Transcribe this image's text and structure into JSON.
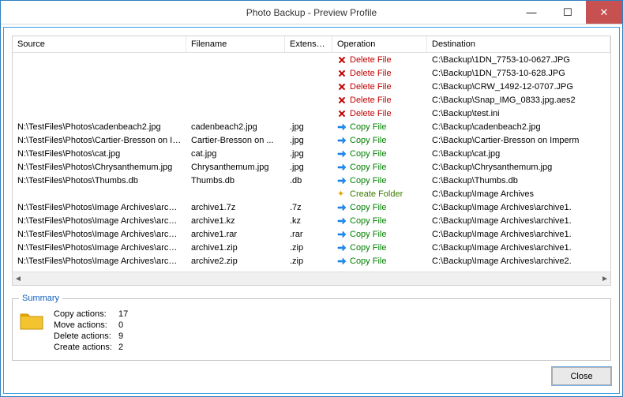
{
  "window": {
    "title": "Photo Backup - Preview Profile"
  },
  "columns": {
    "source": "Source",
    "filename": "Filename",
    "extension": "Extension",
    "operation": "Operation",
    "destination": "Destination"
  },
  "rows": [
    {
      "source": "",
      "filename": "",
      "ext": "",
      "op": "Delete File",
      "opType": "delete",
      "dest": "C:\\Backup\\1DN_7753-10-0627.JPG"
    },
    {
      "source": "",
      "filename": "",
      "ext": "",
      "op": "Delete File",
      "opType": "delete",
      "dest": "C:\\Backup\\1DN_7753-10-628.JPG"
    },
    {
      "source": "",
      "filename": "",
      "ext": "",
      "op": "Delete File",
      "opType": "delete",
      "dest": "C:\\Backup\\CRW_1492-12-0707.JPG"
    },
    {
      "source": "",
      "filename": "",
      "ext": "",
      "op": "Delete File",
      "opType": "delete",
      "dest": "C:\\Backup\\Snap_IMG_0833.jpg.aes2"
    },
    {
      "source": "",
      "filename": "",
      "ext": "",
      "op": "Delete File",
      "opType": "delete",
      "dest": "C:\\Backup\\test.ini"
    },
    {
      "source": "N:\\TestFiles\\Photos\\cadenbeach2.jpg",
      "filename": "cadenbeach2.jpg",
      "ext": ".jpg",
      "op": "Copy File",
      "opType": "copy",
      "dest": "C:\\Backup\\cadenbeach2.jpg"
    },
    {
      "source": "N:\\TestFiles\\Photos\\Cartier-Bresson on Im...",
      "filename": "Cartier-Bresson on ...",
      "ext": ".jpg",
      "op": "Copy File",
      "opType": "copy",
      "dest": "C:\\Backup\\Cartier-Bresson on Imperm"
    },
    {
      "source": "N:\\TestFiles\\Photos\\cat.jpg",
      "filename": "cat.jpg",
      "ext": ".jpg",
      "op": "Copy File",
      "opType": "copy",
      "dest": "C:\\Backup\\cat.jpg"
    },
    {
      "source": "N:\\TestFiles\\Photos\\Chrysanthemum.jpg",
      "filename": "Chrysanthemum.jpg",
      "ext": ".jpg",
      "op": "Copy File",
      "opType": "copy",
      "dest": "C:\\Backup\\Chrysanthemum.jpg"
    },
    {
      "source": "N:\\TestFiles\\Photos\\Thumbs.db",
      "filename": "Thumbs.db",
      "ext": ".db",
      "op": "Copy File",
      "opType": "copy",
      "dest": "C:\\Backup\\Thumbs.db"
    },
    {
      "source": "",
      "filename": "",
      "ext": "",
      "op": "Create Folder",
      "opType": "create",
      "dest": "C:\\Backup\\Image Archives"
    },
    {
      "source": "N:\\TestFiles\\Photos\\Image Archives\\archiv...",
      "filename": "archive1.7z",
      "ext": ".7z",
      "op": "Copy File",
      "opType": "copy",
      "dest": "C:\\Backup\\Image Archives\\archive1."
    },
    {
      "source": "N:\\TestFiles\\Photos\\Image Archives\\archiv...",
      "filename": "archive1.kz",
      "ext": ".kz",
      "op": "Copy File",
      "opType": "copy",
      "dest": "C:\\Backup\\Image Archives\\archive1."
    },
    {
      "source": "N:\\TestFiles\\Photos\\Image Archives\\archiv...",
      "filename": "archive1.rar",
      "ext": ".rar",
      "op": "Copy File",
      "opType": "copy",
      "dest": "C:\\Backup\\Image Archives\\archive1."
    },
    {
      "source": "N:\\TestFiles\\Photos\\Image Archives\\archiv...",
      "filename": "archive1.zip",
      "ext": ".zip",
      "op": "Copy File",
      "opType": "copy",
      "dest": "C:\\Backup\\Image Archives\\archive1."
    },
    {
      "source": "N:\\TestFiles\\Photos\\Image Archives\\archiv...",
      "filename": "archive2.zip",
      "ext": ".zip",
      "op": "Copy File",
      "opType": "copy",
      "dest": "C:\\Backup\\Image Archives\\archive2."
    }
  ],
  "summary": {
    "title": "Summary",
    "copy_label": "Copy actions:",
    "copy_count": "17",
    "move_label": "Move actions:",
    "move_count": "0",
    "delete_label": "Delete actions:",
    "delete_count": "9",
    "create_label": "Create actions:",
    "create_count": "2"
  },
  "buttons": {
    "close": "Close"
  }
}
